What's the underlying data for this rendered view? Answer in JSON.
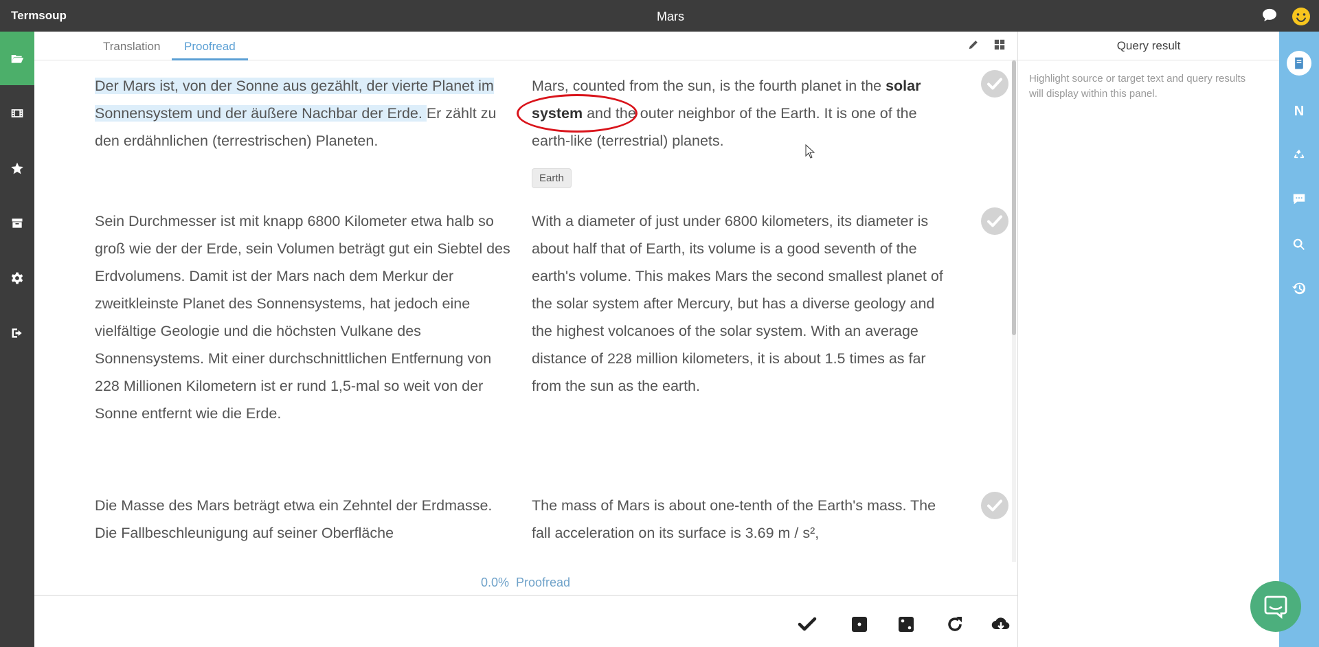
{
  "app": {
    "name": "Termsoup",
    "document_title": "Mars"
  },
  "tabs": [
    {
      "label": "Translation",
      "active": false
    },
    {
      "label": "Proofread",
      "active": true
    }
  ],
  "left_nav": [
    {
      "icon": "folder-open-icon",
      "active": true
    },
    {
      "icon": "film-icon",
      "active": false
    },
    {
      "icon": "star-icon",
      "active": false
    },
    {
      "icon": "archive-icon",
      "active": false
    },
    {
      "icon": "gear-icon",
      "active": false
    },
    {
      "icon": "sign-out-icon",
      "active": false
    }
  ],
  "segments": [
    {
      "source_highlight": "Der Mars ist, von der Sonne aus gezählt, der vierte Planet im Sonnensystem und der äußere Nachbar der Erde. ",
      "source_rest": "Er zählt zu den erdähnlichen (terrestrischen) Planeten.",
      "target_before": "Mars, counted from the sun, is the fourth planet in the ",
      "target_term": "solar system",
      "target_after": " and the outer neighbor of the Earth. It is one of the earth-like (terrestrial) planets.",
      "term_chip": "Earth"
    },
    {
      "source": "Sein Durchmesser ist mit knapp 6800 Kilometer etwa halb so groß wie der der Erde, sein Volumen beträgt gut ein Siebtel des Erdvolumens. Damit ist der Mars nach dem Merkur der zweitkleinste Planet des Sonnensystems, hat jedoch eine vielfältige Geologie und die höchsten Vulkane des Sonnensystems. Mit einer durchschnittlichen Entfernung von 228 Millionen Kilometern ist er rund 1,5-mal so weit von der Sonne entfernt wie die Erde.",
      "target": "With a diameter of just under 6800 kilometers, its diameter is about half that of Earth, its volume is a good seventh of the earth's volume. This makes Mars the second smallest planet of the solar system after Mercury, but has a diverse geology and the highest volcanoes of the solar system. With an average distance of 228 million kilometers, it is about 1.5 times as far from the sun as the earth."
    },
    {
      "source": "Die Masse des Mars beträgt etwa ein Zehntel der Erdmasse. Die Fallbeschleunigung auf seiner Oberfläche",
      "target": "The mass of Mars is about one-tenth of the Earth's mass.  The fall acceleration on its surface is 3.69 m / s²,"
    }
  ],
  "progress": {
    "percent_text": "0.0%",
    "label": "Proofread"
  },
  "query_panel": {
    "title": "Query result",
    "placeholder": "Highlight source or target text and query results will display within this panel."
  },
  "right_nav": {
    "letter_n": "N"
  },
  "colors": {
    "topbar": "#3c3c3c",
    "active_nav": "#4caf6a",
    "accent": "#5a9fd4",
    "right_nav": "#79bde8",
    "highlight": "#ddeefa",
    "annotation_circle": "#d9141b"
  }
}
